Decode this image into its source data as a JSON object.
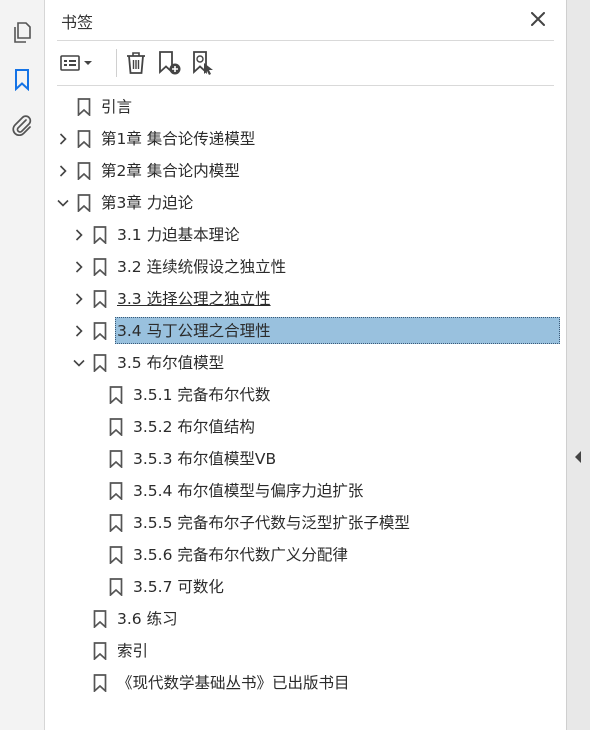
{
  "panel": {
    "title": "书签"
  },
  "bookmarks": [
    {
      "label": "引言",
      "level": 0,
      "expander": "none"
    },
    {
      "label": "第1章 集合论传递模型",
      "level": 0,
      "expander": "collapsed"
    },
    {
      "label": "第2章 集合论内模型",
      "level": 0,
      "expander": "collapsed"
    },
    {
      "label": "第3章 力迫论",
      "level": 0,
      "expander": "expanded"
    },
    {
      "label": "3.1 力迫基本理论",
      "level": 1,
      "expander": "collapsed"
    },
    {
      "label": "3.2 连续统假设之独立性",
      "level": 1,
      "expander": "collapsed"
    },
    {
      "label": "3.3 选择公理之独立性",
      "level": 1,
      "expander": "collapsed",
      "state": "hover"
    },
    {
      "label": "3.4 马丁公理之合理性",
      "level": 1,
      "expander": "collapsed",
      "state": "selected"
    },
    {
      "label": "3.5 布尔值模型",
      "level": 1,
      "expander": "expanded"
    },
    {
      "label": "3.5.1 完备布尔代数",
      "level": 2,
      "expander": "none"
    },
    {
      "label": "3.5.2 布尔值结构",
      "level": 2,
      "expander": "none"
    },
    {
      "label": "3.5.3 布尔值模型VB",
      "level": 2,
      "expander": "none"
    },
    {
      "label": "3.5.4 布尔值模型与偏序力迫扩张",
      "level": 2,
      "expander": "none"
    },
    {
      "label": "3.5.5 完备布尔子代数与泛型扩张子模型",
      "level": 2,
      "expander": "none"
    },
    {
      "label": "3.5.6 完备布尔代数广义分配律",
      "level": 2,
      "expander": "none"
    },
    {
      "label": "3.5.7 可数化",
      "level": 2,
      "expander": "none"
    },
    {
      "label": "3.6 练习",
      "level": 1,
      "expander": "none"
    },
    {
      "label": "索引",
      "level": 1,
      "expander": "none"
    },
    {
      "label": "《现代数学基础丛书》已出版书目",
      "level": 1,
      "expander": "none"
    }
  ],
  "colors": {
    "selected_bg": "#99c1de",
    "accent": "#1473e6"
  },
  "icons": {
    "rail": [
      "pages-icon",
      "bookmark-icon",
      "attachment-icon"
    ],
    "toolbar": [
      "options-menu-icon",
      "delete-bookmark-icon",
      "new-bookmark-icon",
      "bookmark-from-selection-icon"
    ]
  }
}
